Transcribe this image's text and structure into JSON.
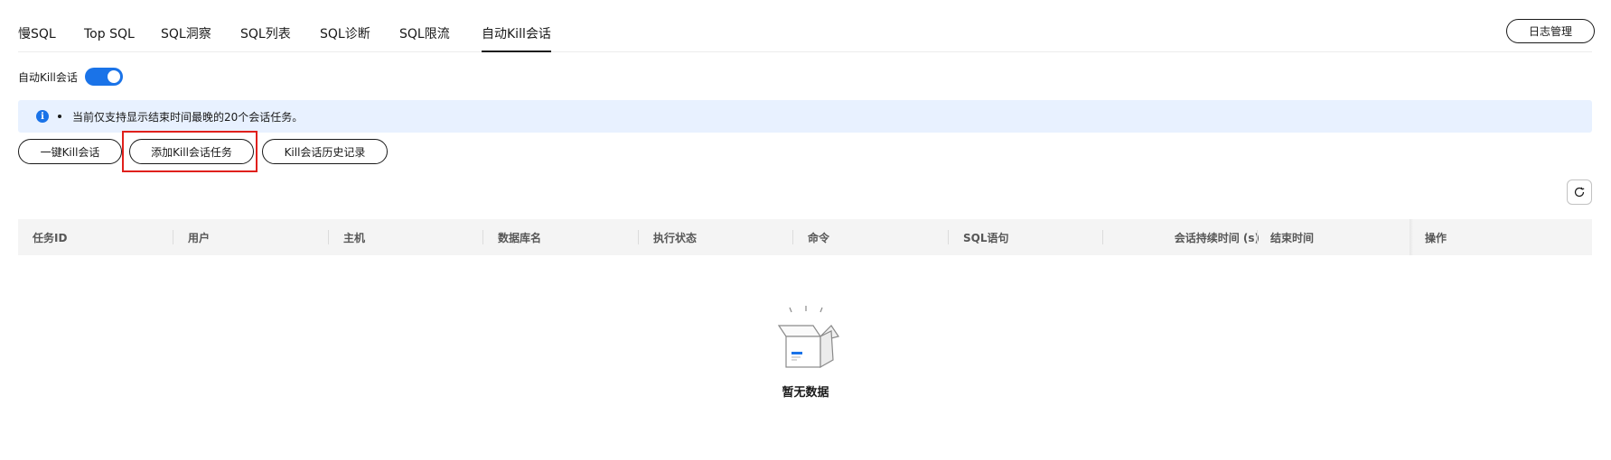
{
  "tabs": [
    {
      "label": "慢SQL"
    },
    {
      "label": "Top SQL"
    },
    {
      "label": "SQL洞察"
    },
    {
      "label": "SQL列表"
    },
    {
      "label": "SQL诊断"
    },
    {
      "label": "SQL限流"
    },
    {
      "label": "自动Kill会话",
      "active": true
    }
  ],
  "log_button": "日志管理",
  "auto_kill": {
    "label": "自动Kill会话",
    "enabled": true
  },
  "banner": {
    "icon": "info-icon",
    "text": "当前仅支持显示结束时间最晚的20个会话任务。"
  },
  "actions": {
    "one_key_kill": "一键Kill会话",
    "add_task": "添加Kill会话任务",
    "history": "Kill会话历史记录"
  },
  "refresh_icon": "refresh-icon",
  "table": {
    "columns": [
      "任务ID",
      "用户",
      "主机",
      "数据库名",
      "执行状态",
      "命令",
      "SQL语句",
      "会话持续时间 (s)",
      "结束时间",
      "操作"
    ],
    "rows": []
  },
  "empty_state": {
    "icon": "empty-box-icon",
    "text": "暂无数据"
  },
  "colors": {
    "accent": "#1a73e8",
    "highlight": "#e0201c",
    "banner_bg": "#e8f1ff"
  }
}
